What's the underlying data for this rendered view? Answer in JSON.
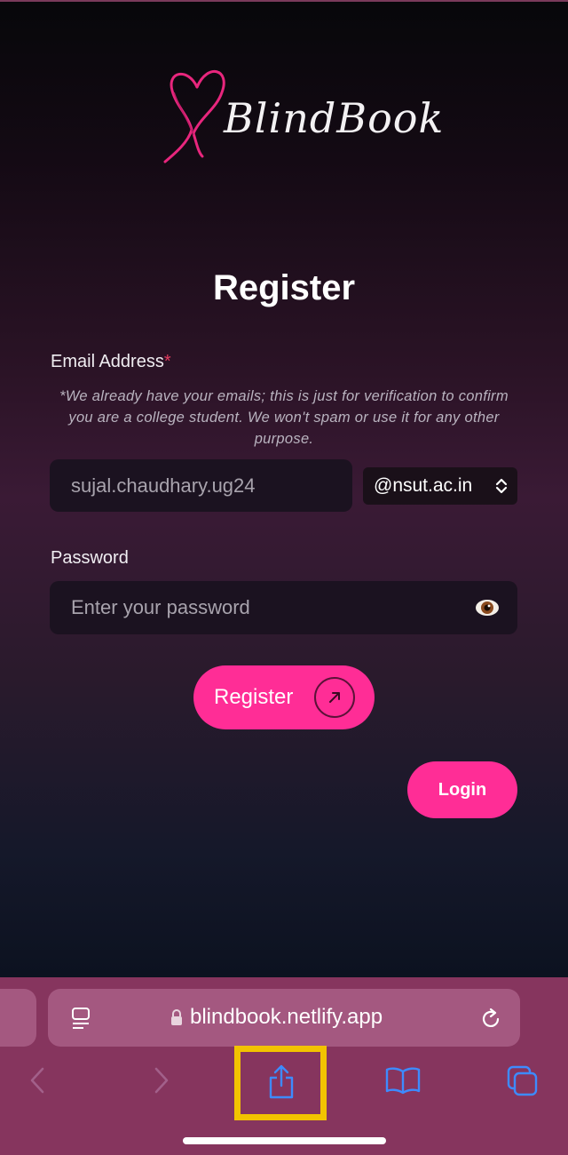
{
  "brand": {
    "name": "BlindBook",
    "accent": "#ff2d96"
  },
  "form": {
    "title": "Register",
    "email_label": "Email Address",
    "required_mark": "*",
    "email_note": "*We already have your emails; this is just for verification to confirm you are a college student. We won't spam or use it for any other purpose.",
    "email_value": "sujal.chaudhary.ug24",
    "domain_selected": "@nsut.ac.in",
    "password_label": "Password",
    "password_placeholder": "Enter your password",
    "register_button": "Register",
    "login_button": "Login"
  },
  "browser": {
    "url": "blindbook.netlify.app",
    "icons": [
      "reader-icon",
      "lock-icon",
      "reload-icon",
      "back-icon",
      "forward-icon",
      "share-icon",
      "bookmarks-icon",
      "tabs-icon"
    ]
  }
}
